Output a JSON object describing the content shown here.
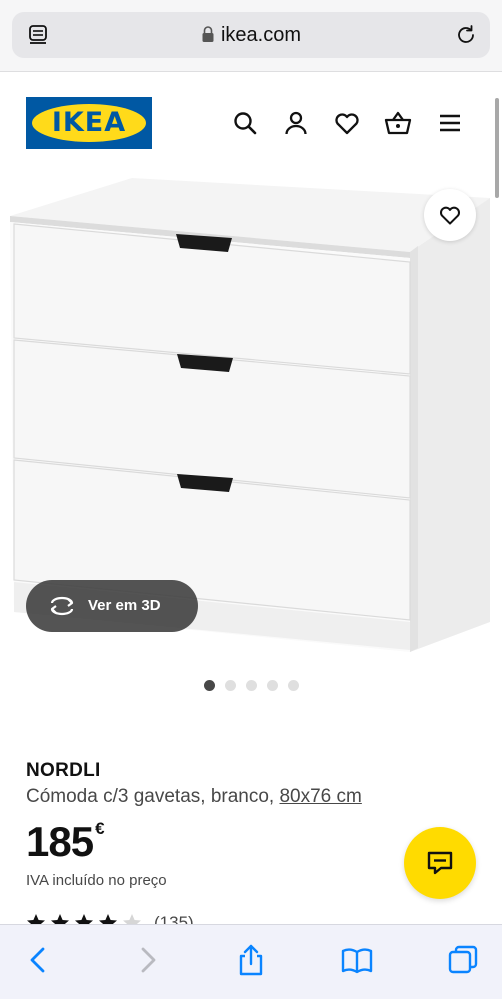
{
  "browser": {
    "domain": "ikea.com"
  },
  "brand": {
    "logo_text": "IKEA",
    "blue": "#0058a3",
    "yellow": "#ffda1a"
  },
  "header": {
    "icons": [
      "search-icon",
      "account-icon",
      "heart-icon",
      "basket-icon",
      "menu-icon"
    ]
  },
  "product": {
    "image_alt_icons": [
      "heart-icon",
      "rotate-3d-icon"
    ],
    "view_3d_label": "Ver em 3D",
    "carousel": {
      "count": 5,
      "active": 1
    },
    "name": "NORDLI",
    "description": "Cómoda c/3 gavetas, branco, ",
    "size": "80x76 cm",
    "price": "185",
    "currency": "€",
    "vat_note": "IVA incluído no preço",
    "rating": {
      "stars": 4,
      "max": 5,
      "count": "(135)"
    }
  },
  "chat": {
    "icon": "chat-icon",
    "color": "#ffdb00"
  },
  "toolbar": {
    "icons": [
      "back-icon",
      "forward-icon",
      "share-icon",
      "bookmarks-icon",
      "tabs-icon"
    ],
    "accent": "#0a84ff"
  }
}
